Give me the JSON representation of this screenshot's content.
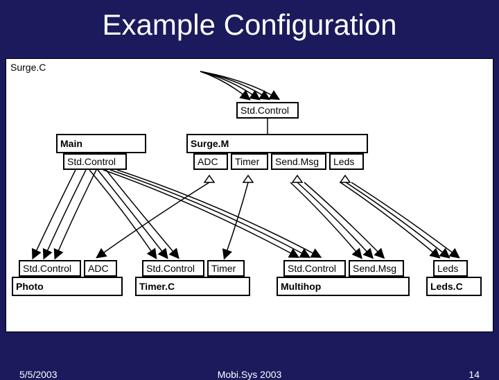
{
  "slide": {
    "title": "Example Configuration",
    "date": "5/5/2003",
    "venue": "Mobi.Sys 2003",
    "page_number": "14"
  },
  "diagram": {
    "container_label": "Surge.C",
    "main_module": "Main",
    "main_provides": "Std.Control",
    "surge_module": "Surge.M",
    "surge_provides_top": "Std.Control",
    "surge_uses": [
      "ADC",
      "Timer",
      "Send.Msg",
      "Leds"
    ],
    "photo_module": "Photo",
    "photo_provides": [
      "Std.Control",
      "ADC"
    ],
    "timer_module": "Timer.C",
    "timer_provides": [
      "Std.Control",
      "Timer"
    ],
    "multihop_module": "Multihop",
    "multihop_provides": [
      "Std.Control",
      "Send.Msg"
    ],
    "leds_module": "Leds.C",
    "leds_provides": "Leds"
  }
}
